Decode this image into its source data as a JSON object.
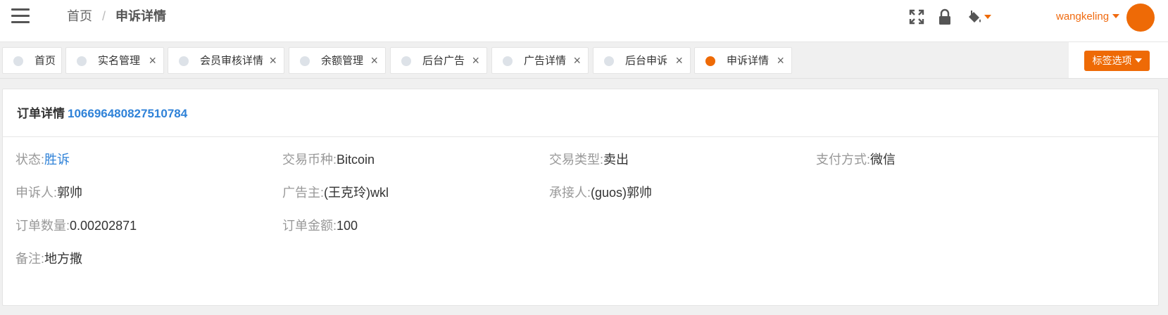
{
  "header": {
    "breadcrumb_home": "首页",
    "breadcrumb_sep": "/",
    "breadcrumb_current": "申诉详情",
    "username": "wangkeling",
    "accent_color": "#ee6a06"
  },
  "tabs": [
    {
      "label": "首页",
      "closable": false,
      "active": false
    },
    {
      "label": "实名管理",
      "closable": true,
      "active": false
    },
    {
      "label": "会员审核详情",
      "closable": true,
      "active": false
    },
    {
      "label": "余额管理",
      "closable": true,
      "active": false
    },
    {
      "label": "后台广告",
      "closable": true,
      "active": false
    },
    {
      "label": "广告详情",
      "closable": true,
      "active": false
    },
    {
      "label": "后台申诉",
      "closable": true,
      "active": false
    },
    {
      "label": "申诉详情",
      "closable": true,
      "active": true
    }
  ],
  "tab_close_glyph": "×",
  "tag_options_label": "标签选项",
  "panel": {
    "title": "订单详情",
    "order_no": "106696480827510784"
  },
  "fields": {
    "status": {
      "label": "状态:",
      "value": "胜诉"
    },
    "coin": {
      "label": "交易币种:",
      "value": "Bitcoin"
    },
    "trade_type": {
      "label": "交易类型:",
      "value": "卖出"
    },
    "pay_method": {
      "label": "支付方式:",
      "value": "微信"
    },
    "appellant": {
      "label": "申诉人:",
      "value": "郭帅"
    },
    "advertiser": {
      "label": "广告主:",
      "value": "(王克玲)wkl"
    },
    "acceptor": {
      "label": "承接人:",
      "value": "(guos)郭帅"
    },
    "order_qty": {
      "label": "订单数量:",
      "value": "0.00202871"
    },
    "order_amount": {
      "label": "订单金额:",
      "value": "100"
    },
    "remark": {
      "label": "备注:",
      "value": "地方撒"
    }
  }
}
